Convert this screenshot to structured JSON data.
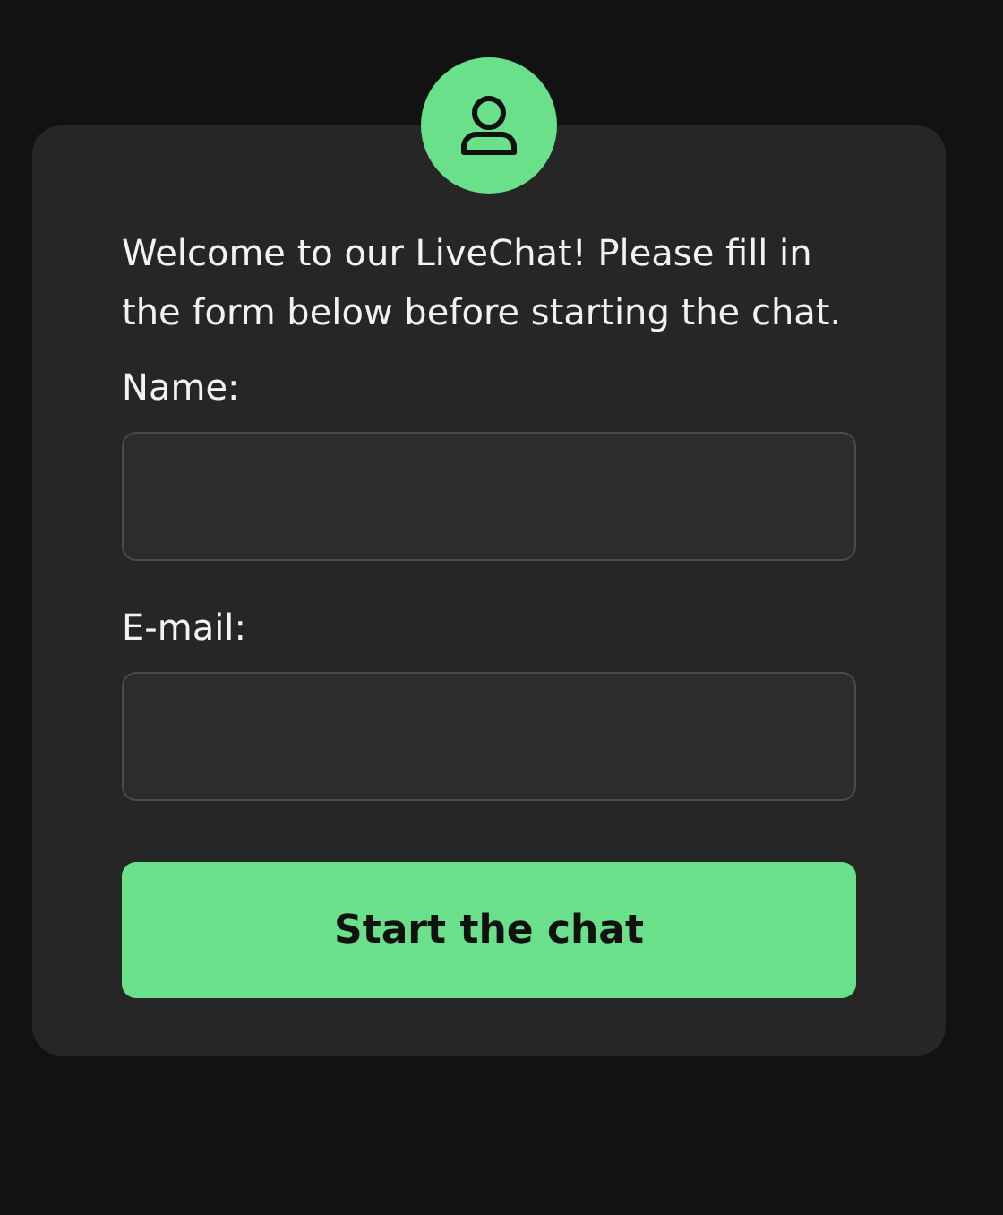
{
  "intro": "Welcome to our LiveChat! Please fill in the form below before starting the chat.",
  "fields": [
    {
      "label": "Name:"
    },
    {
      "label": "E-mail:"
    }
  ],
  "button": "Start the chat"
}
